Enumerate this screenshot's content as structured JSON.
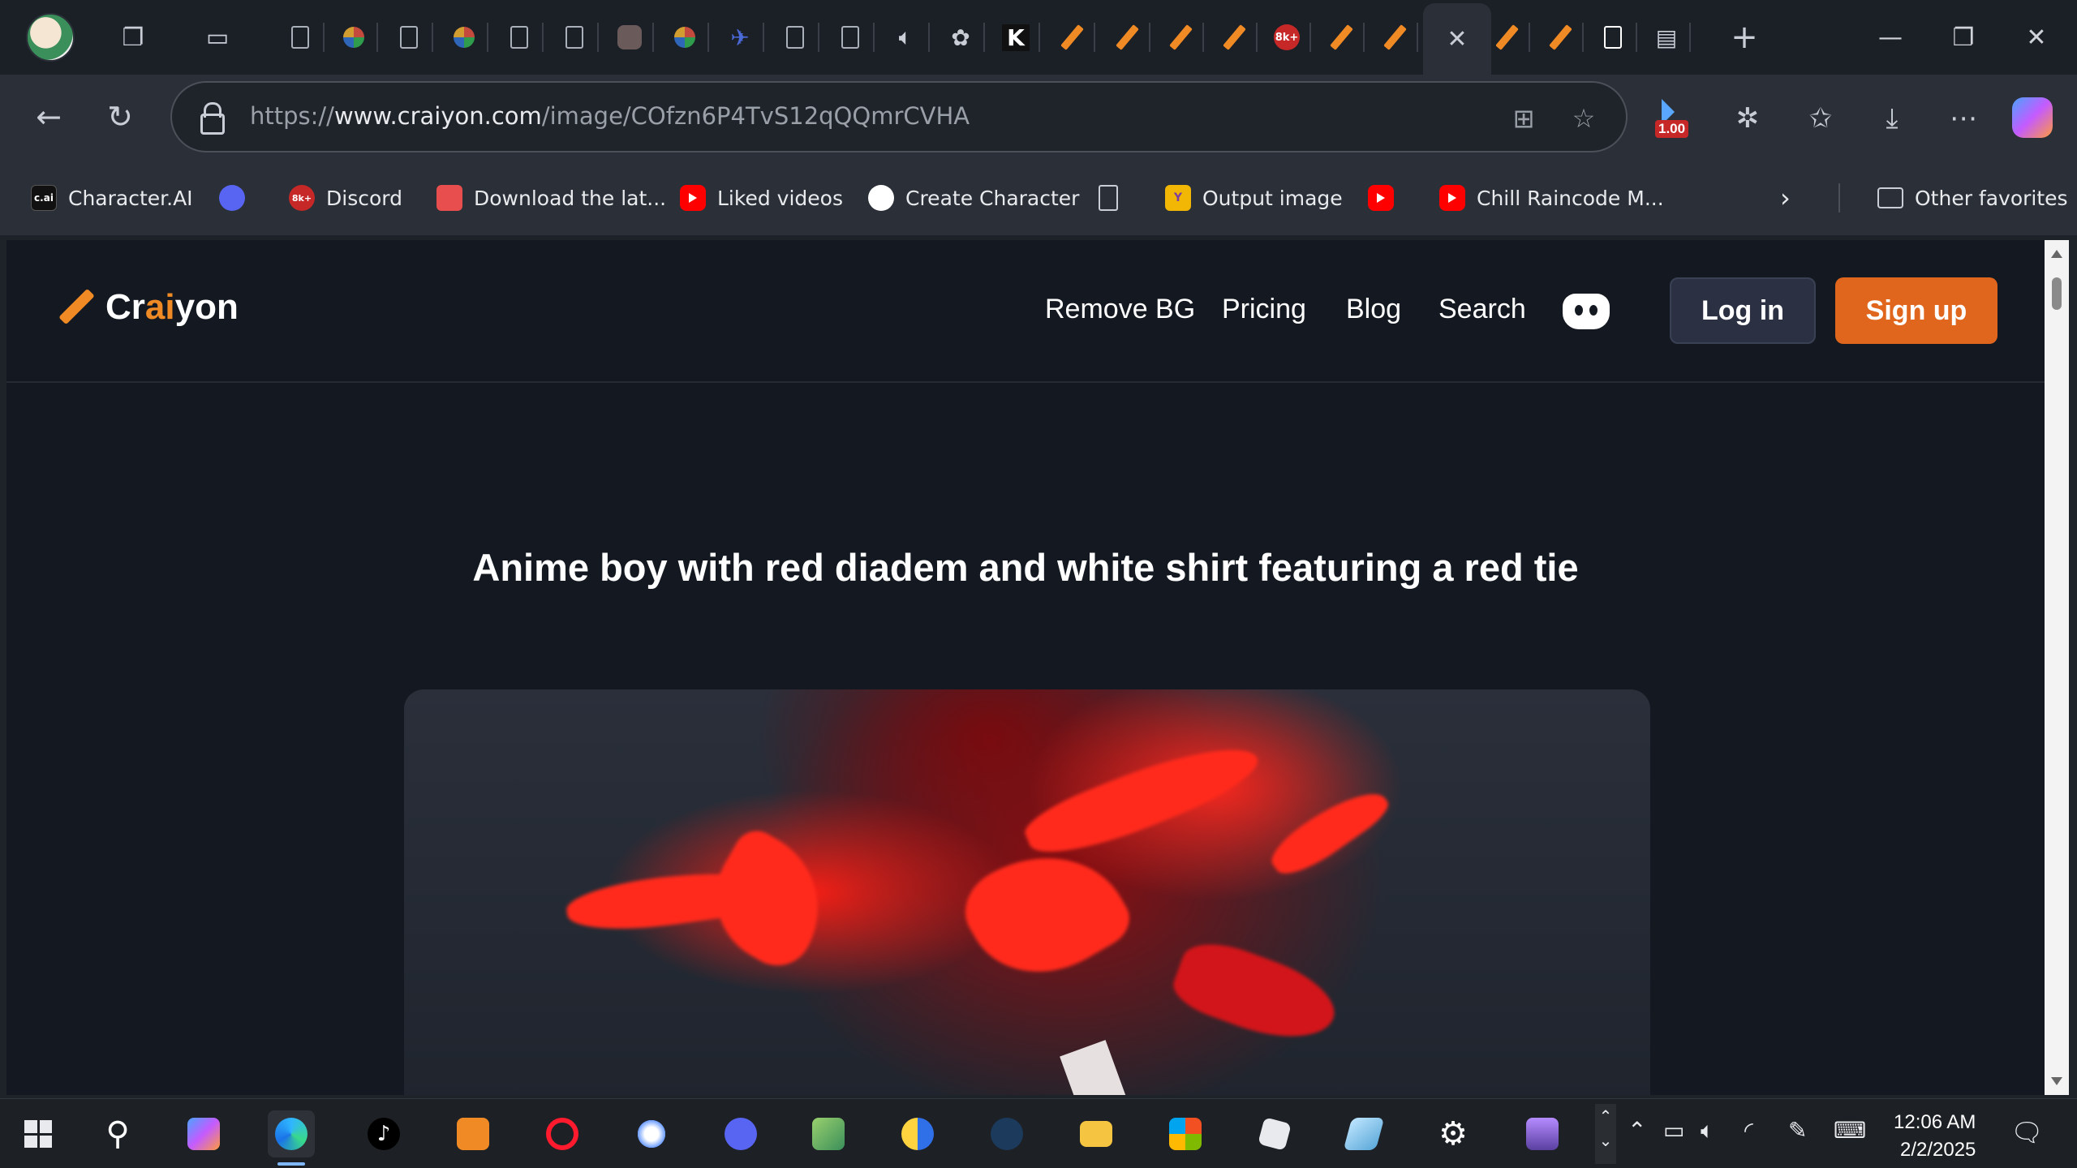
{
  "browser": {
    "url_prefix": "https://",
    "url_host": "www.craiyon.com",
    "url_path": "/image/COfzn6P4TvS12qQQmrCVHA",
    "zoom_badge": "1.00",
    "tab_badge": "8k+"
  },
  "favorites": [
    {
      "label": "Character.AI",
      "icon": "c.ai"
    },
    {
      "label": "",
      "icon": "discord-icon"
    },
    {
      "label": "Discord",
      "icon": "8k+"
    },
    {
      "label": "Download the lat...",
      "icon": "download-icon"
    },
    {
      "label": "Liked videos",
      "icon": "youtube-icon"
    },
    {
      "label": "Create Character",
      "icon": "openai-icon"
    },
    {
      "label": "",
      "icon": "document-icon"
    },
    {
      "label": "Output image",
      "icon": "output-icon"
    },
    {
      "label": "",
      "icon": "youtube-icon"
    },
    {
      "label": "Chill Raincode M...",
      "icon": "youtube-icon"
    }
  ],
  "other_favorites": "Other favorites",
  "site": {
    "logo_pre": "Cr",
    "logo_ai": "ai",
    "logo_post": "yon",
    "nav": [
      "Remove BG",
      "Pricing",
      "Blog",
      "Search"
    ],
    "login": "Log in",
    "signup": "Sign up",
    "prompt_title": "Anime boy with red diadem and white shirt featuring a red tie"
  },
  "taskbar": {
    "time": "12:06 AM",
    "date": "2/2/2025"
  },
  "colors": {
    "accent": "#e0661e",
    "page_bg": "#141820"
  }
}
